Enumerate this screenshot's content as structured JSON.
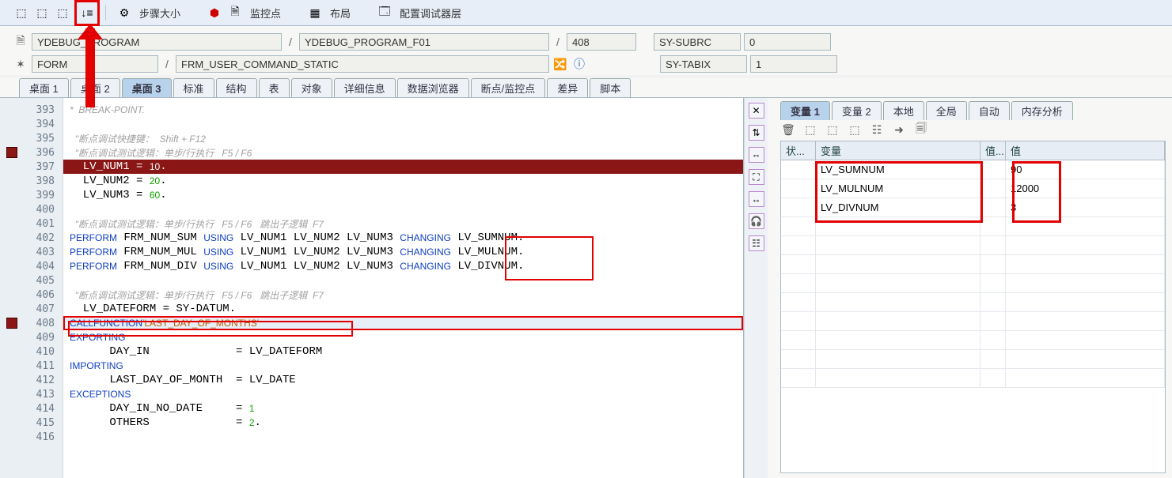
{
  "toolbar": {
    "step_size_label": "步骤大小",
    "watchpoint_label": "监控点",
    "layout_label": "布局",
    "config_layers_label": "配置调试器层"
  },
  "source_row": {
    "program": "YDEBUG_PROGRAM",
    "include": "YDEBUG_PROGRAM_F01",
    "line": "408",
    "sy_subrc_label": "SY-SUBRC",
    "sy_subrc_value": "0"
  },
  "event_row": {
    "event": "FORM",
    "subroutine": "FRM_USER_COMMAND_STATIC",
    "sy_tabix_label": "SY-TABIX",
    "sy_tabix_value": "1"
  },
  "tabs": [
    "桌面 1",
    "桌面 2",
    "桌面 3",
    "标准",
    "结构",
    "表",
    "对象",
    "详细信息",
    "数据浏览器",
    "断点/监控点",
    "差异",
    "脚本"
  ],
  "active_tab_index": 2,
  "code": [
    {
      "n": 393,
      "raw": "*  BREAK-POINT.",
      "cls": "cmt"
    },
    {
      "n": 394,
      "raw": "",
      "cls": ""
    },
    {
      "n": 395,
      "raw": "  \"断点调试快捷键：  Shift + F12",
      "cls": "cmt"
    },
    {
      "n": 396,
      "raw": "  \"断点调试测试逻辑：单步/行执行   F5 / F6",
      "cls": "cmt",
      "bp": true
    },
    {
      "n": 397,
      "raw": "  LV_NUM1 = 10.",
      "hl": true
    },
    {
      "n": 398,
      "raw": "  LV_NUM2 = 20."
    },
    {
      "n": 399,
      "raw": "  LV_NUM3 = 60."
    },
    {
      "n": 400,
      "raw": ""
    },
    {
      "n": 401,
      "raw": "  \"断点调试测试逻辑：单步/行执行   F5 / F6   跳出子逻辑  F7",
      "cls": "cmt"
    },
    {
      "n": 402,
      "raw": "  PERFORM FRM_NUM_SUM USING LV_NUM1 LV_NUM2 LV_NUM3 CHANGING LV_SUMNUM."
    },
    {
      "n": 403,
      "raw": "  PERFORM FRM_NUM_MUL USING LV_NUM1 LV_NUM2 LV_NUM3 CHANGING LV_MULNUM."
    },
    {
      "n": 404,
      "raw": "  PERFORM FRM_NUM_DIV USING LV_NUM1 LV_NUM2 LV_NUM3 CHANGING LV_DIVNUM."
    },
    {
      "n": 405,
      "raw": ""
    },
    {
      "n": 406,
      "raw": "  \"断点调试测试逻辑：单步/行执行   F5 / F6   跳出子逻辑  F7",
      "cls": "cmt"
    },
    {
      "n": 407,
      "raw": "  LV_DATEFORM = SY-DATUM."
    },
    {
      "n": 408,
      "raw": "  CALL FUNCTION 'LAST_DAY_OF_MONTHS'",
      "cur": true,
      "bp": true
    },
    {
      "n": 409,
      "raw": "    EXPORTING"
    },
    {
      "n": 410,
      "raw": "      DAY_IN             = LV_DATEFORM"
    },
    {
      "n": 411,
      "raw": "    IMPORTING"
    },
    {
      "n": 412,
      "raw": "      LAST_DAY_OF_MONTH  = LV_DATE"
    },
    {
      "n": 413,
      "raw": "    EXCEPTIONS"
    },
    {
      "n": 414,
      "raw": "      DAY_IN_NO_DATE     = 1"
    },
    {
      "n": 415,
      "raw": "      OTHERS             = 2."
    },
    {
      "n": 416,
      "raw": ""
    }
  ],
  "var_tabs": [
    "变量 1",
    "变量 2",
    "本地",
    "全局",
    "自动",
    "内存分析"
  ],
  "active_var_tab_index": 0,
  "var_cols": {
    "status": "状...",
    "name": "变量",
    "vt": "值...",
    "value": "值"
  },
  "vars": [
    {
      "name": "LV_SUMNUM",
      "value": "90"
    },
    {
      "name": "LV_MULNUM",
      "value": "12000"
    },
    {
      "name": "LV_DIVNUM",
      "value": "3"
    }
  ]
}
